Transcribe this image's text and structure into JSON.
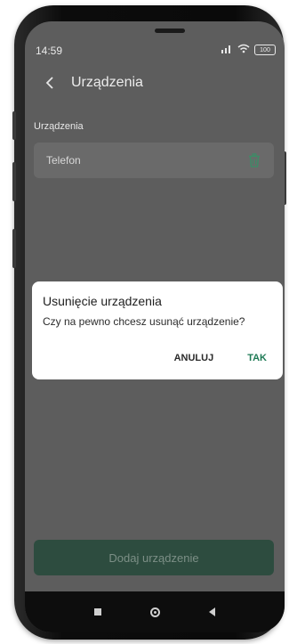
{
  "status_bar": {
    "time": "14:59",
    "signal_icon": "signal-icon",
    "wifi_icon": "wifi-icon",
    "battery_level": "100"
  },
  "app_bar": {
    "back_icon": "chevron-left-icon",
    "title": "Urządzenia"
  },
  "devices_section": {
    "label": "Urządzenia",
    "items": [
      {
        "name": "Telefon",
        "action_icon": "trash-icon"
      }
    ]
  },
  "dialog": {
    "title": "Usunięcie urządzenia",
    "message": "Czy na pewno chcesz usunąć urządzenie?",
    "cancel_label": "ANULUJ",
    "confirm_label": "TAK"
  },
  "add_device_button": {
    "label": "Dodaj urządzenie"
  },
  "colors": {
    "accent": "#1e7a55",
    "button_disabled_bg": "#2d4c3f",
    "overlay_bg": "#5d5d5d"
  }
}
